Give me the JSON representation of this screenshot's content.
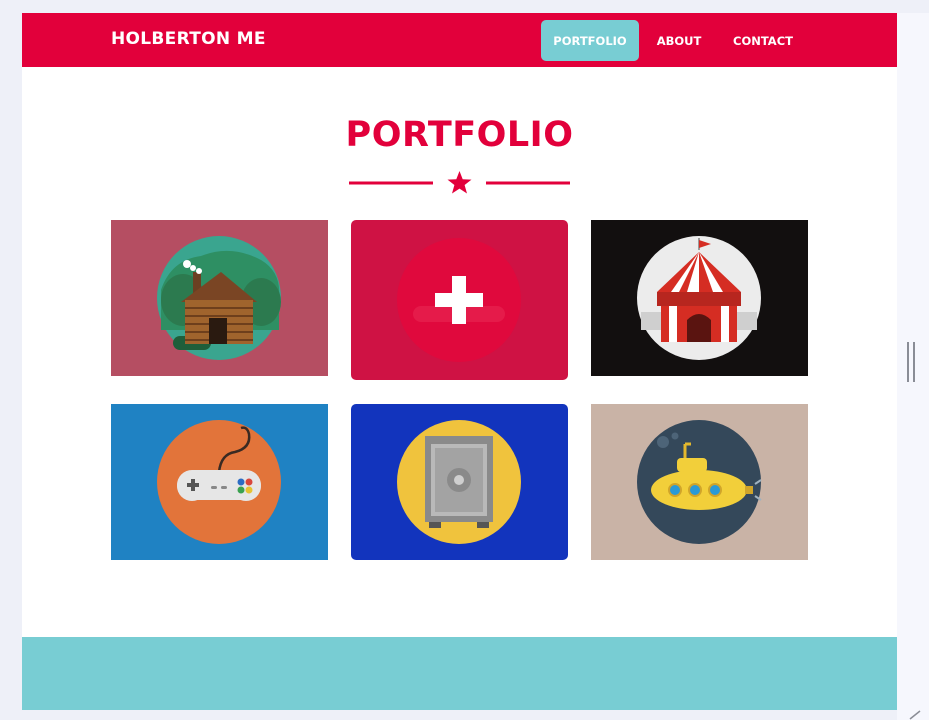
{
  "navbar": {
    "brand": "HOLBERTON ME",
    "links": [
      {
        "label": "PORTFOLIO",
        "active": true
      },
      {
        "label": "ABOUT",
        "active": false
      },
      {
        "label": "CONTACT",
        "active": false
      }
    ]
  },
  "portfolio": {
    "title": "PORTFOLIO",
    "items": [
      {
        "icon": "log-cabin-icon",
        "bg": "#b54e62"
      },
      {
        "icon": "plus-icon",
        "bg": "#cf1244",
        "hovered": true
      },
      {
        "icon": "circus-tent-icon",
        "bg": "#120f0f"
      },
      {
        "icon": "game-controller-icon",
        "bg": "#1f82c3"
      },
      {
        "icon": "safe-icon",
        "bg": "#1234bd"
      },
      {
        "icon": "submarine-icon",
        "bg": "#c9b3a6"
      }
    ]
  },
  "colors": {
    "accent": "#e2003b",
    "teal": "#78cdd3",
    "white": "#ffffff"
  }
}
